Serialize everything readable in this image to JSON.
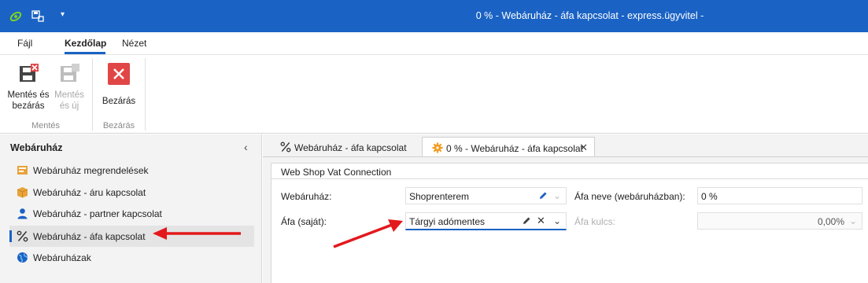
{
  "window": {
    "title": "0 % - Webáruház - áfa kapcsolat - express.ügyvitel -",
    "qa_dropdown": "▾"
  },
  "ribbon": {
    "tabs": [
      "Fájl",
      "Kezdőlap",
      "Nézet"
    ],
    "active_tab": "Kezdőlap",
    "groups": [
      {
        "label": "Mentés",
        "buttons": [
          {
            "label_line1": "Mentés és",
            "label_line2": "bezárás",
            "enabled": true,
            "icon": "save-close-icon"
          },
          {
            "label_line1": "Mentés",
            "label_line2": "és új",
            "enabled": false,
            "icon": "save-new-icon"
          }
        ]
      },
      {
        "label": "Bezárás",
        "buttons": [
          {
            "label_line1": "Bezárás",
            "enabled": true,
            "icon": "close-red-icon"
          }
        ]
      }
    ]
  },
  "sidebar": {
    "title": "Webáruház",
    "collapse_glyph": "‹",
    "items": [
      {
        "label": "Webáruház megrendelések",
        "icon": "orders-icon",
        "active": false
      },
      {
        "label": "Webáruház - áru kapcsolat",
        "icon": "box-icon",
        "active": false
      },
      {
        "label": "Webáruház - partner kapcsolat",
        "icon": "person-icon",
        "active": false
      },
      {
        "label": "Webáruház - áfa kapcsolat",
        "icon": "percent-icon",
        "active": true
      },
      {
        "label": "Webáruházak",
        "icon": "globe-icon",
        "active": false
      }
    ]
  },
  "doc_tabs": [
    {
      "label": "Webáruház - áfa kapcsolat",
      "icon": "percent-icon",
      "active": false
    },
    {
      "label": "0 % - Webáruház - áfa kapcsolat",
      "icon": "gear-orange-icon",
      "active": true,
      "close": "✕"
    }
  ],
  "form": {
    "panel_title": "Web Shop Vat Connection",
    "webshop_label": "Webáruház:",
    "webshop_value": "Shoprenterem",
    "vat_own_label": "Áfa (saját):",
    "vat_own_value": "Tárgyi adómentes",
    "vat_name_label": "Áfa neve (webáruházban):",
    "vat_name_value": "0 %",
    "vat_rate_label": "Áfa kulcs:",
    "vat_rate_value": "0,00%",
    "clear_glyph": "✕",
    "chevron_glyph": "⌄"
  },
  "colors": {
    "accent": "#1a62c4",
    "annotation_arrow": "#e3191c",
    "close_button": "#e04646"
  }
}
